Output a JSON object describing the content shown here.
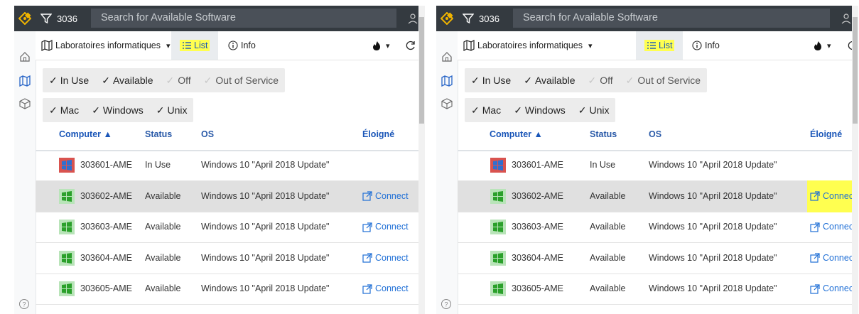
{
  "panels": [
    {
      "filter_count": "3036",
      "search_placeholder": "Search for Available Software",
      "toolbar": {
        "location": "Laboratoires informatiques",
        "list_label": "List",
        "info_label": "Info",
        "list_highlighted": true
      },
      "status_filters": [
        {
          "label": "In Use",
          "on": true
        },
        {
          "label": "Available",
          "on": true
        },
        {
          "label": "Off",
          "on": false
        },
        {
          "label": "Out of Service",
          "on": false
        }
      ],
      "os_filters": [
        {
          "label": "Mac",
          "on": true
        },
        {
          "label": "Windows",
          "on": true
        },
        {
          "label": "Unix",
          "on": true
        }
      ],
      "columns": {
        "computer": "Computer ▲",
        "status": "Status",
        "os": "OS",
        "remote": "Éloigné"
      },
      "rows": [
        {
          "name": "303601-AME",
          "status": "In Use",
          "os": "Windows 10 \"April 2018 Update\"",
          "connect": "",
          "in_use": true
        },
        {
          "name": "303602-AME",
          "status": "Available",
          "os": "Windows 10 \"April 2018 Update\"",
          "connect": "Connect",
          "selected": true
        },
        {
          "name": "303603-AME",
          "status": "Available",
          "os": "Windows 10 \"April 2018 Update\"",
          "connect": "Connect"
        },
        {
          "name": "303604-AME",
          "status": "Available",
          "os": "Windows 10 \"April 2018 Update\"",
          "connect": "Connect"
        },
        {
          "name": "303605-AME",
          "status": "Available",
          "os": "Windows 10 \"April 2018 Update\"",
          "connect": "Connect"
        }
      ]
    },
    {
      "filter_count": "3036",
      "search_placeholder": "Search for Available Software",
      "toolbar": {
        "location": "Laboratoires informatiques",
        "list_label": "List",
        "info_label": "Info",
        "list_highlighted": true
      },
      "status_filters": [
        {
          "label": "In Use",
          "on": true
        },
        {
          "label": "Available",
          "on": true
        },
        {
          "label": "Off",
          "on": false
        },
        {
          "label": "Out of Service",
          "on": false
        }
      ],
      "os_filters": [
        {
          "label": "Mac",
          "on": true
        },
        {
          "label": "Windows",
          "on": true
        },
        {
          "label": "Unix",
          "on": true
        }
      ],
      "columns": {
        "computer": "Computer ▲",
        "status": "Status",
        "os": "OS",
        "remote": "Éloigné"
      },
      "rows": [
        {
          "name": "303601-AME",
          "status": "In Use",
          "os": "Windows 10 \"April 2018 Update\"",
          "connect": "",
          "in_use": true
        },
        {
          "name": "303602-AME",
          "status": "Available",
          "os": "Windows 10 \"April 2018 Update\"",
          "connect": "Connect",
          "selected": true,
          "connect_highlighted": true
        },
        {
          "name": "303603-AME",
          "status": "Available",
          "os": "Windows 10 \"April 2018 Update\"",
          "connect": "Connect"
        },
        {
          "name": "303604-AME",
          "status": "Available",
          "os": "Windows 10 \"April 2018 Update\"",
          "connect": "Connect"
        },
        {
          "name": "303605-AME",
          "status": "Available",
          "os": "Windows 10 \"April 2018 Update\"",
          "connect": "Connect"
        }
      ]
    }
  ],
  "colors": {
    "topbar": "#343a40",
    "logo": "#f0b400",
    "link": "#1f6fd6",
    "highlight": "#ffff50",
    "in_use_icon_bg": "#d9534f",
    "available_icon_bg": "#5cb85c"
  },
  "icons": [
    "logo-icon",
    "filter-icon",
    "user-icon",
    "home-icon",
    "map-icon",
    "cube-icon",
    "help-icon",
    "map-book-icon",
    "list-icon",
    "info-icon",
    "fire-icon",
    "refresh-icon",
    "windows-icon",
    "external-link-icon"
  ]
}
